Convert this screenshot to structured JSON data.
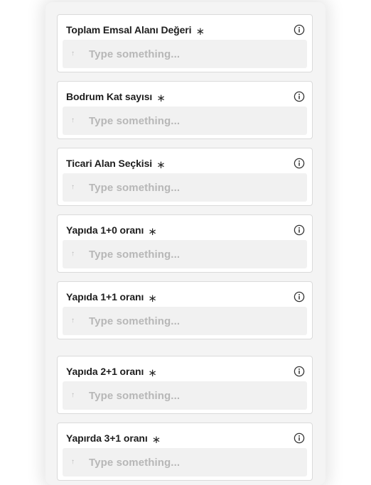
{
  "colors": {
    "panel_background": "#f4f4f4",
    "card_background": "#ffffff",
    "input_background": "#f1f1f1",
    "placeholder": "#b7b7b7",
    "label": "#1d1d1d"
  },
  "fields": [
    {
      "label": "Toplam Emsal Alanı Değeri",
      "required_mark": "∗",
      "placeholder": "Type something...",
      "input_icon": "sort-arrow-icon",
      "info_icon": "info-icon"
    },
    {
      "label": "Bodrum Kat sayısı",
      "required_mark": "∗",
      "placeholder": "Type something...",
      "input_icon": "sort-arrow-icon",
      "info_icon": "info-icon"
    },
    {
      "label": "Ticari Alan Seçkisi",
      "required_mark": "∗",
      "placeholder": "Type something...",
      "input_icon": "sort-arrow-icon",
      "info_icon": "info-icon"
    },
    {
      "label": "Yapıda 1+0 oranı",
      "required_mark": "∗",
      "placeholder": "Type something...",
      "input_icon": "sort-arrow-icon",
      "info_icon": "info-icon"
    },
    {
      "label": "Yapıda 1+1 oranı",
      "required_mark": "∗",
      "placeholder": "Type something...",
      "input_icon": "sort-arrow-icon",
      "info_icon": "info-icon"
    },
    {
      "label": "Yapıda 2+1 oranı",
      "required_mark": "∗",
      "placeholder": "Type something...",
      "input_icon": "sort-arrow-icon",
      "info_icon": "info-icon"
    },
    {
      "label": "Yapırda 3+1 oranı",
      "required_mark": "∗",
      "placeholder": "Type something...",
      "input_icon": "sort-arrow-icon",
      "info_icon": "info-icon"
    }
  ]
}
